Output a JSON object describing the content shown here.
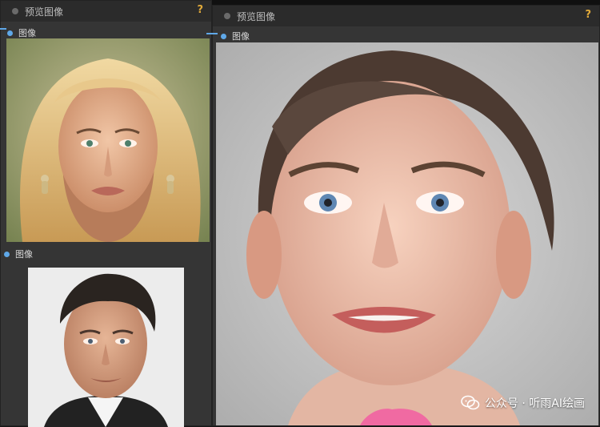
{
  "nodes": [
    {
      "title": "预览图像",
      "help": "?",
      "slots": [
        {
          "label": "图像",
          "image": "woman-portrait"
        },
        {
          "label": "图像",
          "image": "man-portrait"
        }
      ]
    },
    {
      "title": "预览图像",
      "help": "?",
      "slots": [
        {
          "label": "图像",
          "image": "girl-portrait"
        }
      ]
    }
  ],
  "watermark": {
    "text": "公众号 · 听雨AI绘画",
    "icon": "wechat-icon"
  },
  "colors": {
    "node_bg": "#353535",
    "header_bg": "#2b2b2b",
    "slot_dot": "#5fa8e8",
    "help_accent": "#e0a93a"
  }
}
